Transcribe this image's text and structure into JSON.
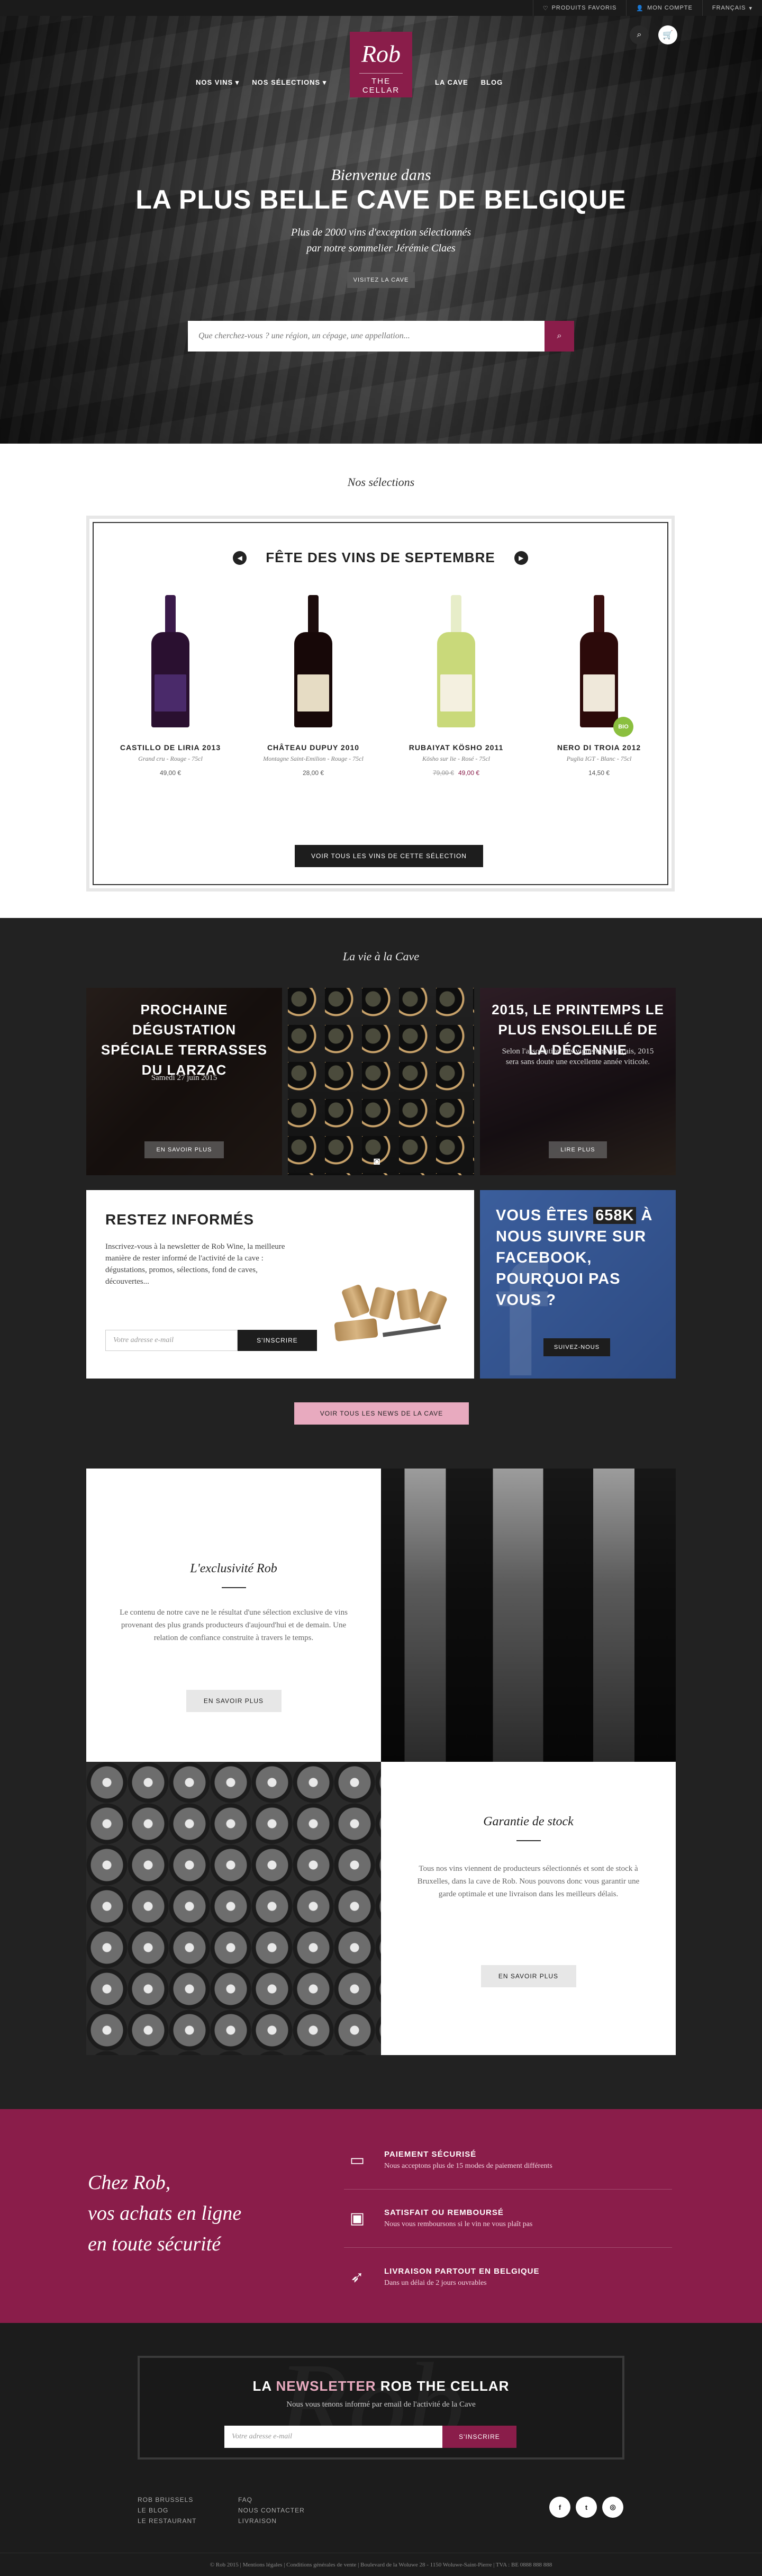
{
  "topbar": {
    "favorites": "Produits favoris",
    "account": "Mon compte",
    "language": "Français"
  },
  "logo": {
    "script": "Rob",
    "sub": "The Cellar"
  },
  "nav": {
    "left": [
      "Nos vins",
      "Nos sélections"
    ],
    "right": [
      "La cave",
      "Blog"
    ]
  },
  "hero": {
    "welcome": "Bienvenue dans",
    "title": "La plus belle cave de Belgique",
    "subtitle_line1": "Plus de 2000 vins d'exception sélectionnés",
    "subtitle_line2": "par notre sommelier Jérémie Claes",
    "cta": "Visitez la cave",
    "search_placeholder": "Que cherchez-vous ? une région, un cépage, une appellation..."
  },
  "selections": {
    "section_title": "Nos sélections",
    "heading": "Fête des vins de septembre",
    "button": "Voir tous les vins de cette sélection",
    "products": [
      {
        "name": "Castillo de Liria 2013",
        "desc": "Grand cru - Rouge - 75cl",
        "price": "49,00 €",
        "old_price": "",
        "bio": ""
      },
      {
        "name": "Château Dupuy 2010",
        "desc": "Montagne Saint-Emilion - Rouge - 75cl",
        "price": "28,00 €",
        "old_price": "",
        "bio": ""
      },
      {
        "name": "Rubaiyat Kösho 2011",
        "desc": "Kösho sur lie - Rosé - 75cl",
        "price": "49,00 €",
        "old_price": "79,00 €",
        "bio": ""
      },
      {
        "name": "Nero di Troia 2012",
        "desc": "Puglia IGT - Blanc - 75cl",
        "price": "14,50 €",
        "old_price": "",
        "bio": "BIO"
      }
    ]
  },
  "vie": {
    "section_title": "La vie à la Cave",
    "tasting": {
      "title": "Prochaine dégustation spéciale terrasses du Larzac",
      "date": "Samedi 27 juin 2015",
      "button": "En savoir plus"
    },
    "vintage": {
      "title": "2015, le printemps le plus ensoleillé de la décennie",
      "text": "Selon l'association des vignerons français, 2015 sera sans doute une excellente année viticole.",
      "button": "Lire plus"
    },
    "newsletter": {
      "title": "Restez informés",
      "text": "Inscrivez-vous à la newsletter de Rob Wine, la meilleure manière de rester informé de l'activité de la cave : dégustations, promos, sélections, fond de caves, découvertes...",
      "placeholder": "Votre adresse e-mail",
      "button": "S'inscrire"
    },
    "facebook": {
      "pre": "Vous êtes",
      "count": "658K",
      "post": "à nous suivre sur Facebook, pourquoi pas vous ?",
      "button": "Suivez-nous"
    },
    "all_news": "Voir tous les news de la cave"
  },
  "features": {
    "exclusivity": {
      "title": "L'exclusivité Rob",
      "text": "Le contenu de notre cave ne le résultat d'une sélection exclusive de vins provenant des plus grands producteurs d'aujourd'hui et de demain. Une relation de confiance construite à travers le temps.",
      "button": "En savoir plus"
    },
    "stock": {
      "title": "Garantie de stock",
      "text": "Tous nos vins viennent de producteurs sélectionnés et sont de stock à Bruxelles, dans la cave de Rob. Nous pouvons donc vous garantir une garde optimale et une livraison dans les meilleurs délais.",
      "button": "En savoir plus"
    }
  },
  "secure": {
    "title_line1": "Chez Rob,",
    "title_line2": "vos achats en ligne",
    "title_line3": "en toute sécurité",
    "items": [
      {
        "icon": "credit-card-icon",
        "title": "Paiement sécurisé",
        "text": "Nous acceptons plus de 15 modes de paiement différents"
      },
      {
        "icon": "wallet-icon",
        "title": "Satisfait ou remboursé",
        "text": "Nous vous remboursons si le vin ne vous plaît pas"
      },
      {
        "icon": "rocket-icon",
        "title": "Livraison partout en Belgique",
        "text": "Dans un délai de 2 jours ouvrables"
      }
    ]
  },
  "footer": {
    "nl_pre": "La ",
    "nl_pink": "newsletter",
    "nl_post": " Rob The Cellar",
    "nl_sub": "Nous vous tenons informé par email de l'activité de la Cave",
    "nl_placeholder": "Votre adresse e-mail",
    "nl_button": "S'inscrire",
    "col1": [
      "Rob Brussels",
      "Le Blog",
      "Le Restaurant"
    ],
    "col2": [
      "FAQ",
      "Nous contacter",
      "Livraison"
    ],
    "copyright": "© Rob 2015 | Mentions légales | Conditions générales de vente | Boulevard de la Woluwe 28 - 1150 Woluwe-Saint-Pierre | TVA : BE 0888 888 888"
  },
  "colors": {
    "brand": "#8a1d4a",
    "pink": "#e8aabf",
    "dark": "#222222"
  }
}
